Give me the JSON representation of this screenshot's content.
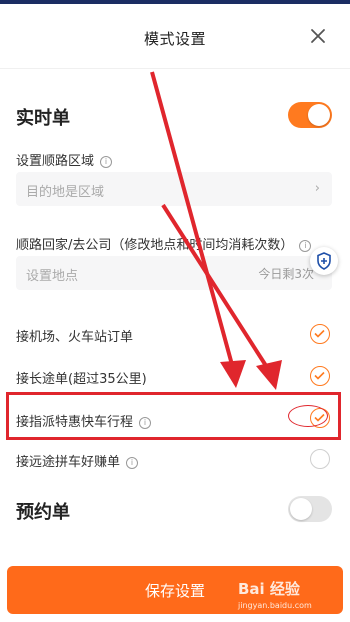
{
  "header": {
    "title": "模式设置",
    "close_icon": "close-icon"
  },
  "realtime": {
    "title": "实时单",
    "toggle_on": true,
    "route_area_label": "设置顺路区域",
    "route_area_placeholder": "目的地是区域",
    "home_label": "顺路回家/去公司（修改地点和时间均消耗次数）",
    "home_placeholder": "设置地点",
    "home_remaining": "今日剩3次"
  },
  "options": [
    {
      "label": "接机场、火车站订单",
      "checked": true,
      "info": false
    },
    {
      "label": "接长途单(超过35公里)",
      "checked": true,
      "info": false
    },
    {
      "label": "接指派特惠快车行程",
      "checked": true,
      "info": true
    },
    {
      "label": "接远途拼车好赚单",
      "checked": false,
      "info": true
    }
  ],
  "reservation": {
    "title": "预约单",
    "toggle_on": false
  },
  "save_label": "保存设置",
  "watermark": {
    "brand": "Bai 经验",
    "url": "jingyan.baidu.com"
  },
  "colors": {
    "accent": "#ff7a1f",
    "highlight": "#e0262d"
  }
}
